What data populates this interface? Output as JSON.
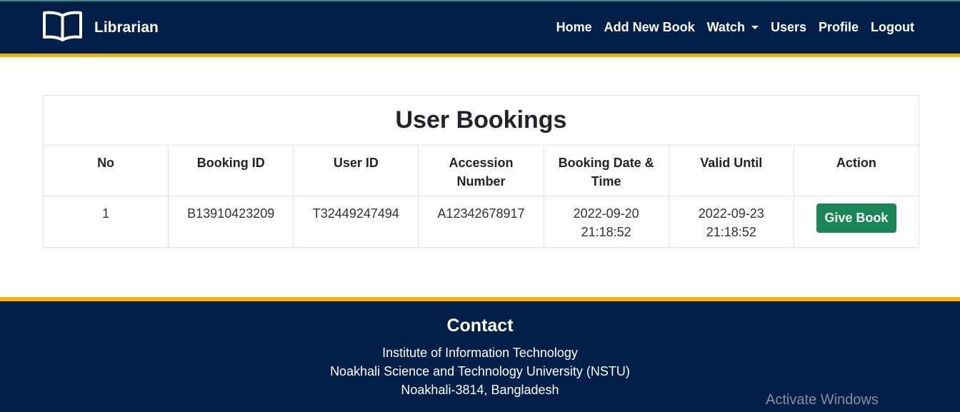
{
  "navbar": {
    "brand": "Librarian",
    "links": [
      {
        "label": "Home"
      },
      {
        "label": "Add New Book"
      },
      {
        "label": "Watch",
        "dropdown": true
      },
      {
        "label": "Users"
      },
      {
        "label": "Profile"
      },
      {
        "label": "Logout"
      }
    ]
  },
  "bookings": {
    "title": "User Bookings",
    "columns": [
      "No",
      "Booking ID",
      "User ID",
      "Accession Number",
      "Booking Date & Time",
      "Valid Until",
      "Action"
    ],
    "rows": [
      {
        "no": "1",
        "booking_id": "B13910423209",
        "user_id": "T32449247494",
        "accession_number": "A12342678917",
        "booking_date_line1": "2022-09-20",
        "booking_date_line2": "21:18:52",
        "valid_until_line1": "2022-09-23",
        "valid_until_line2": "21:18:52",
        "action_label": "Give Book"
      }
    ]
  },
  "footer": {
    "title": "Contact",
    "lines": [
      "Institute of Information Technology",
      "Noakhali Science and Technology University (NSTU)",
      "Noakhali-3814, Bangladesh"
    ]
  },
  "watermark": "Activate Windows",
  "colors": {
    "navbar_bg": "#00204a",
    "accent": "#f4b400",
    "action_button": "#198754"
  },
  "icons": {
    "brand": "open-book-icon",
    "dropdown": "caret-down-icon"
  }
}
